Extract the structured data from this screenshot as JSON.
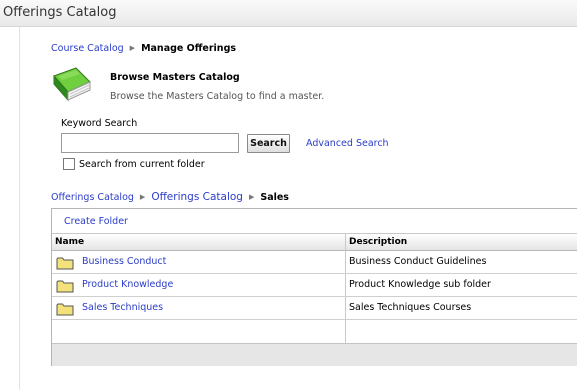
{
  "window": {
    "title": "Offerings Catalog"
  },
  "breadcrumb_top": {
    "link": "Course Catalog",
    "current": "Manage Offerings"
  },
  "browse": {
    "title": "Browse Masters Catalog",
    "description": "Browse the Masters Catalog to find a master.",
    "icon": "green-book-icon"
  },
  "search": {
    "label": "Keyword Search",
    "value": "",
    "placeholder": "",
    "button_label": "Search",
    "advanced_label": "Advanced Search",
    "checkbox_label": "Search from current folder",
    "checkbox_checked": false
  },
  "breadcrumb_folder": {
    "root": "Offerings Catalog",
    "middle": "Offerings Catalog",
    "current": "Sales"
  },
  "panel": {
    "create_folder_label": "Create Folder",
    "columns": [
      "Name",
      "Description"
    ],
    "rows": [
      {
        "name": "Business Conduct",
        "description": "Business Conduct Guidelines"
      },
      {
        "name": "Product Knowledge",
        "description": "Product Knowledge sub folder"
      },
      {
        "name": "Sales Techniques",
        "description": "Sales Techniques Courses"
      }
    ]
  },
  "colors": {
    "link": "#2a3cc8",
    "folder": "#f3e27a",
    "book": "#3a9a2a"
  }
}
